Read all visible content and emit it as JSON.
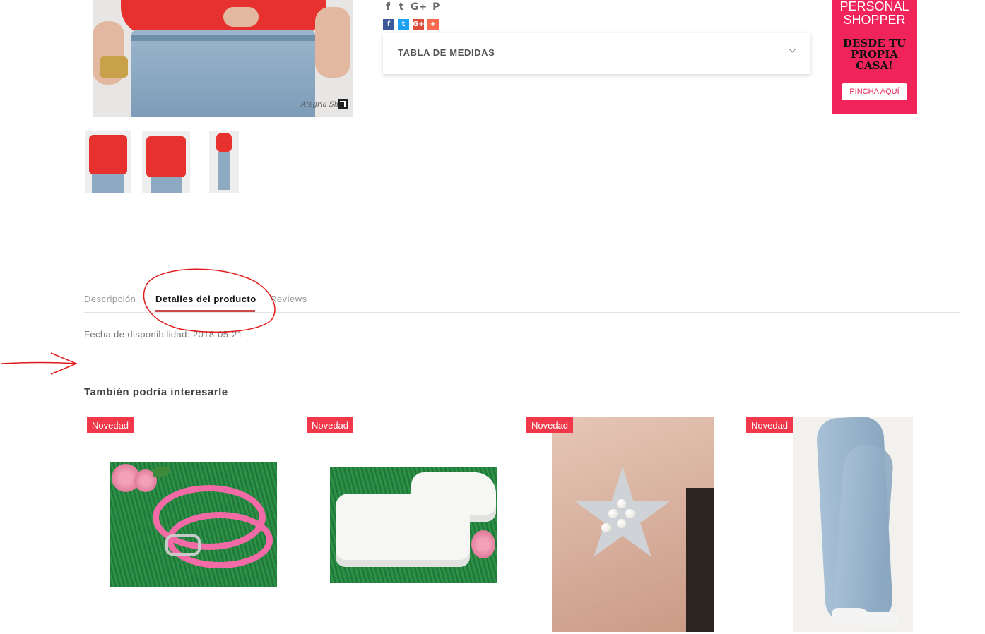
{
  "social": {
    "icons": [
      "facebook-icon",
      "twitter-icon",
      "google-plus-icon",
      "pinterest-icon"
    ],
    "glyphs": {
      "facebook": "f",
      "twitter": "t",
      "google": "G+",
      "pinterest": "P"
    },
    "buttons": {
      "facebook": "f",
      "twitter": "t",
      "google": "G+",
      "addthis": "+"
    },
    "colors": {
      "facebook": "#3b5998",
      "twitter": "#1da1f2",
      "google": "#dd4b39",
      "addthis": "#f8694d"
    }
  },
  "product": {
    "watermark": "Alegria Shop",
    "size_table": {
      "label": "TABLA DE MEDIDAS"
    }
  },
  "banner": {
    "line1": "PERSONAL",
    "line2": "SHOPPER",
    "headline1": "DESDE TU",
    "headline2": "PROPIA",
    "headline3": "CASA!",
    "button": "PINCHA AQUÍ",
    "bg_color": "#f0245a"
  },
  "tabs": {
    "items": [
      "Descripción",
      "Detalles del producto",
      "Reviews"
    ],
    "active": "Detalles del producto",
    "panel_label": "Fecha de disponibilidad:",
    "panel_value": "2018-05-21"
  },
  "related": {
    "title": "También podría interesarle",
    "badge": "Novedad",
    "badge_color": "#f0384a",
    "products": [
      {
        "image": "pink-belt"
      },
      {
        "image": "white-sneakers"
      },
      {
        "image": "star-earring"
      },
      {
        "image": "light-jeans"
      }
    ]
  },
  "annotations": {
    "color": "#e11b1b"
  }
}
